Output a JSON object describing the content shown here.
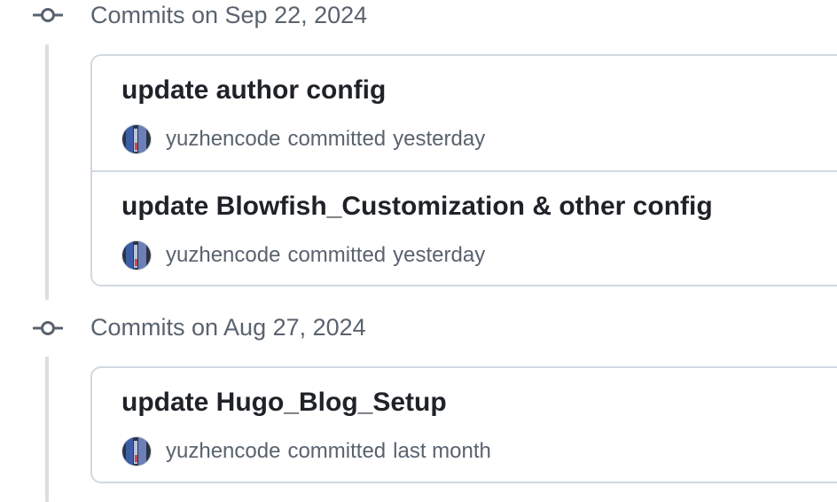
{
  "groups": [
    {
      "title": "Commits on Sep 22, 2024",
      "commits": [
        {
          "title": "update author config",
          "author": "yuzhencode",
          "verb": "committed",
          "when": "yesterday"
        },
        {
          "title": "update Blowfish_Customization & other config",
          "author": "yuzhencode",
          "verb": "committed",
          "when": "yesterday"
        }
      ]
    },
    {
      "title": "Commits on Aug 27, 2024",
      "commits": [
        {
          "title": "update Hugo_Blog_Setup",
          "author": "yuzhencode",
          "verb": "committed",
          "when": "last month"
        }
      ]
    }
  ],
  "icons": {
    "group_marker": "git-commit-icon",
    "avatar": "user-avatar"
  },
  "colors": {
    "text_primary": "#1f2328",
    "text_muted": "#59636e",
    "border": "#d1d9e0",
    "timeline": "#d8dee4"
  }
}
